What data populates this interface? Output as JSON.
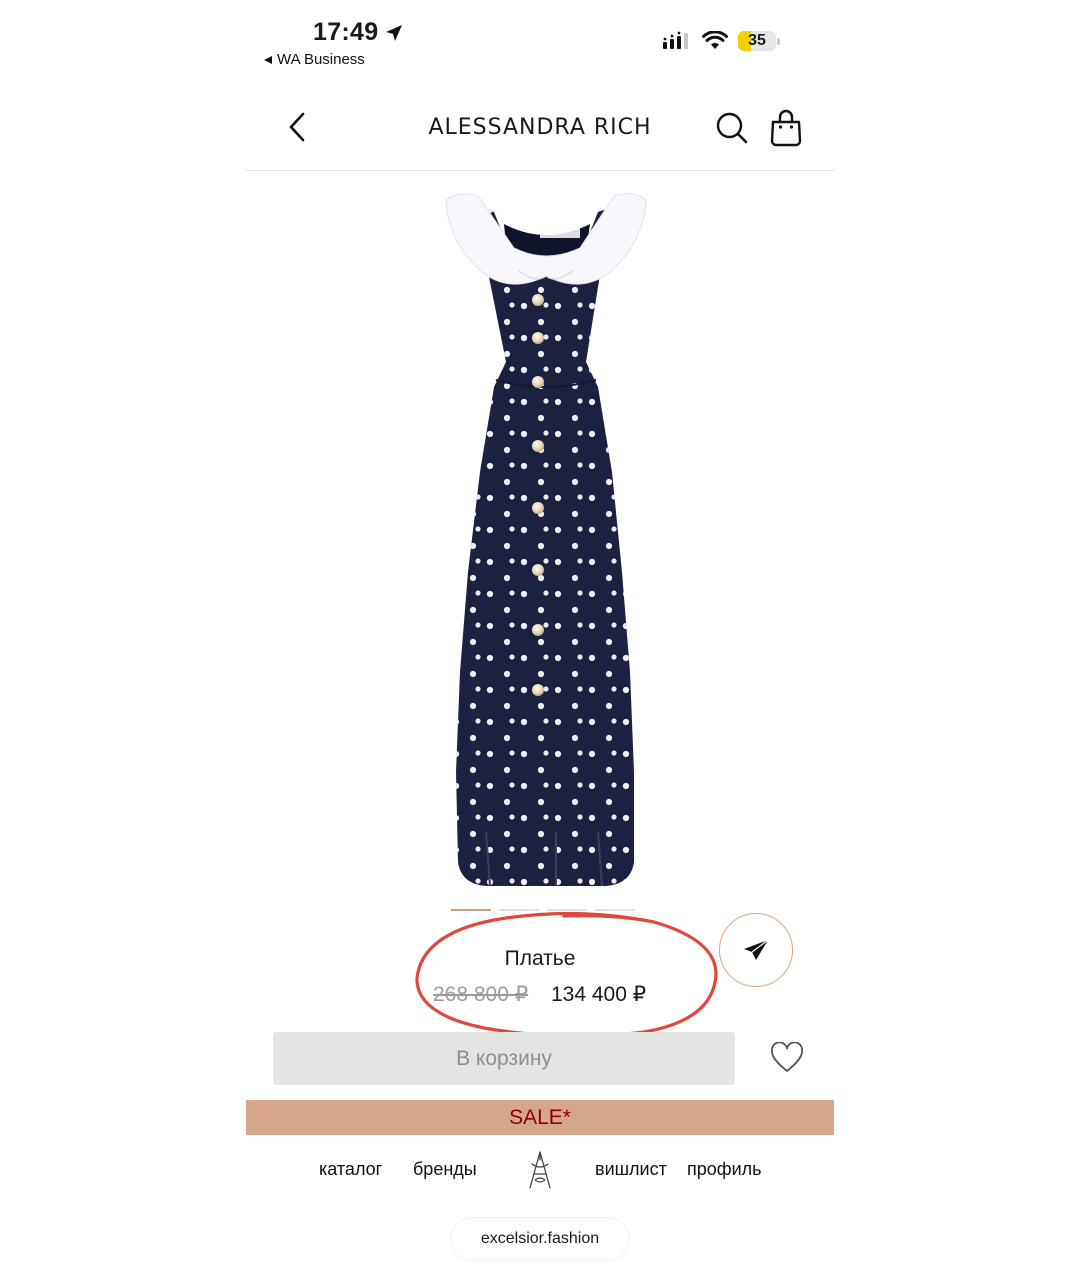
{
  "status_bar": {
    "time": "17:49",
    "back_app": "WA Business",
    "battery": "35"
  },
  "header": {
    "brand": "ALESSANDRA RICH"
  },
  "product": {
    "name": "Платье",
    "price_old": "268 800 ₽",
    "price_new": "134 400 ₽",
    "add_to_cart": "В корзину",
    "image_count": 4,
    "active_image": 1
  },
  "banner": {
    "text": "SALE*"
  },
  "tabbar": {
    "catalog": "каталог",
    "brands": "бренды",
    "wishlist": "вишлист",
    "profile": "профиль"
  },
  "browser": {
    "url": "excelsior.fashion"
  },
  "colors": {
    "sale_banner": "#d5a788",
    "sale_text": "#8b0000",
    "accent": "#c8a27e",
    "annotation": "#e0483e"
  },
  "icons": [
    "location-arrow-icon",
    "back-triangle-icon",
    "cellular-signal-icon",
    "wifi-icon",
    "battery-icon",
    "chevron-left-icon",
    "search-icon",
    "shopping-bag-icon",
    "telegram-share-icon",
    "heart-icon",
    "brand-monogram-icon"
  ]
}
